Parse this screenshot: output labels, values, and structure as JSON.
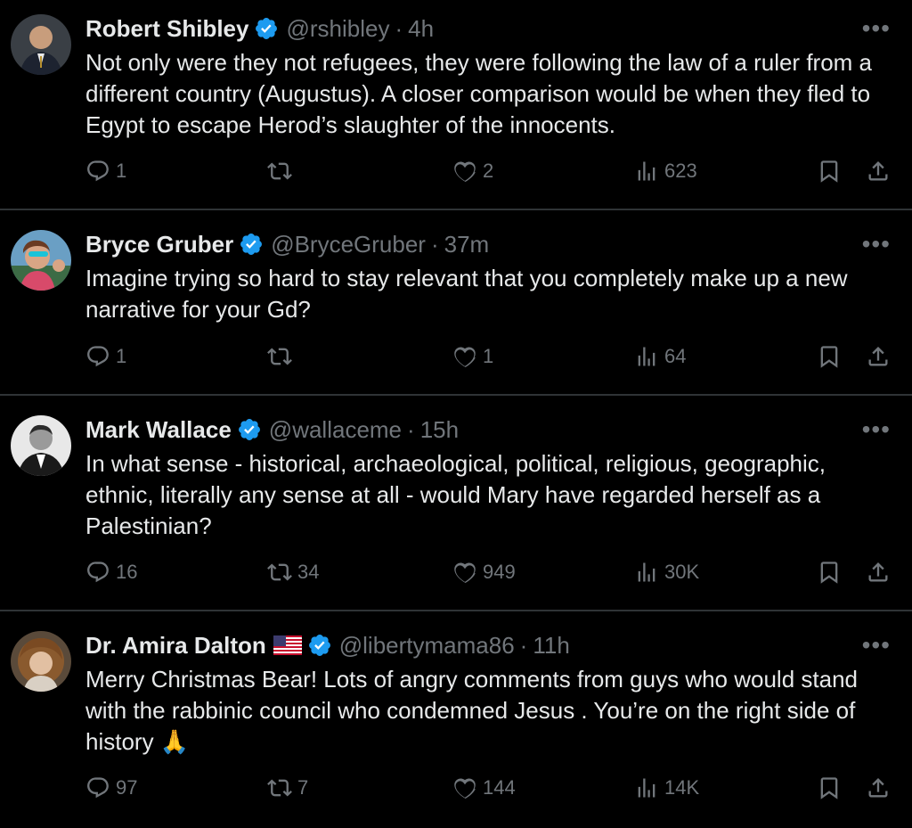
{
  "tweets": [
    {
      "name": "Robert Shibley",
      "handle": "@rshibley",
      "time": "4h",
      "text": "Not only were they not refugees, they were following the law of a ruler from a different country (Augustus). A closer comparison would be when they fled to Egypt to escape Herod’s slaughter of the innocents.",
      "replies": "1",
      "reposts": "",
      "likes": "2",
      "views": "623"
    },
    {
      "name": "Bryce Gruber",
      "handle": "@BryceGruber",
      "time": "37m",
      "text": "Imagine trying so hard to stay relevant that you completely make up a new narrative for your Gd?",
      "replies": "1",
      "reposts": "",
      "likes": "1",
      "views": "64"
    },
    {
      "name": "Mark Wallace",
      "handle": "@wallaceme",
      "time": "15h",
      "text": "In what sense - historical, archaeological, political, religious, geographic, ethnic, literally any sense at all - would Mary have regarded herself as a Palestinian?",
      "replies": "16",
      "reposts": "34",
      "likes": "949",
      "views": "30K"
    },
    {
      "name": "Dr. Amira Dalton",
      "handle": "@libertymama86",
      "time": "11h",
      "text": "Merry Christmas Bear! Lots of angry comments from guys who would stand with the rabbinic council who condemned Jesus . You’re on the right side of history 🙏",
      "replies": "97",
      "reposts": "7",
      "likes": "144",
      "views": "14K"
    }
  ],
  "dot": "·",
  "more": "•••",
  "colors": {
    "background": "#000000",
    "text": "#e7e9ea",
    "muted": "#71767b",
    "verified": "#1d9bf0",
    "divider": "#2f3336"
  },
  "icons": [
    "verified-badge-icon",
    "reply-icon",
    "repost-icon",
    "like-icon",
    "views-icon",
    "bookmark-icon",
    "share-icon",
    "more-icon",
    "us-flag-icon"
  ]
}
